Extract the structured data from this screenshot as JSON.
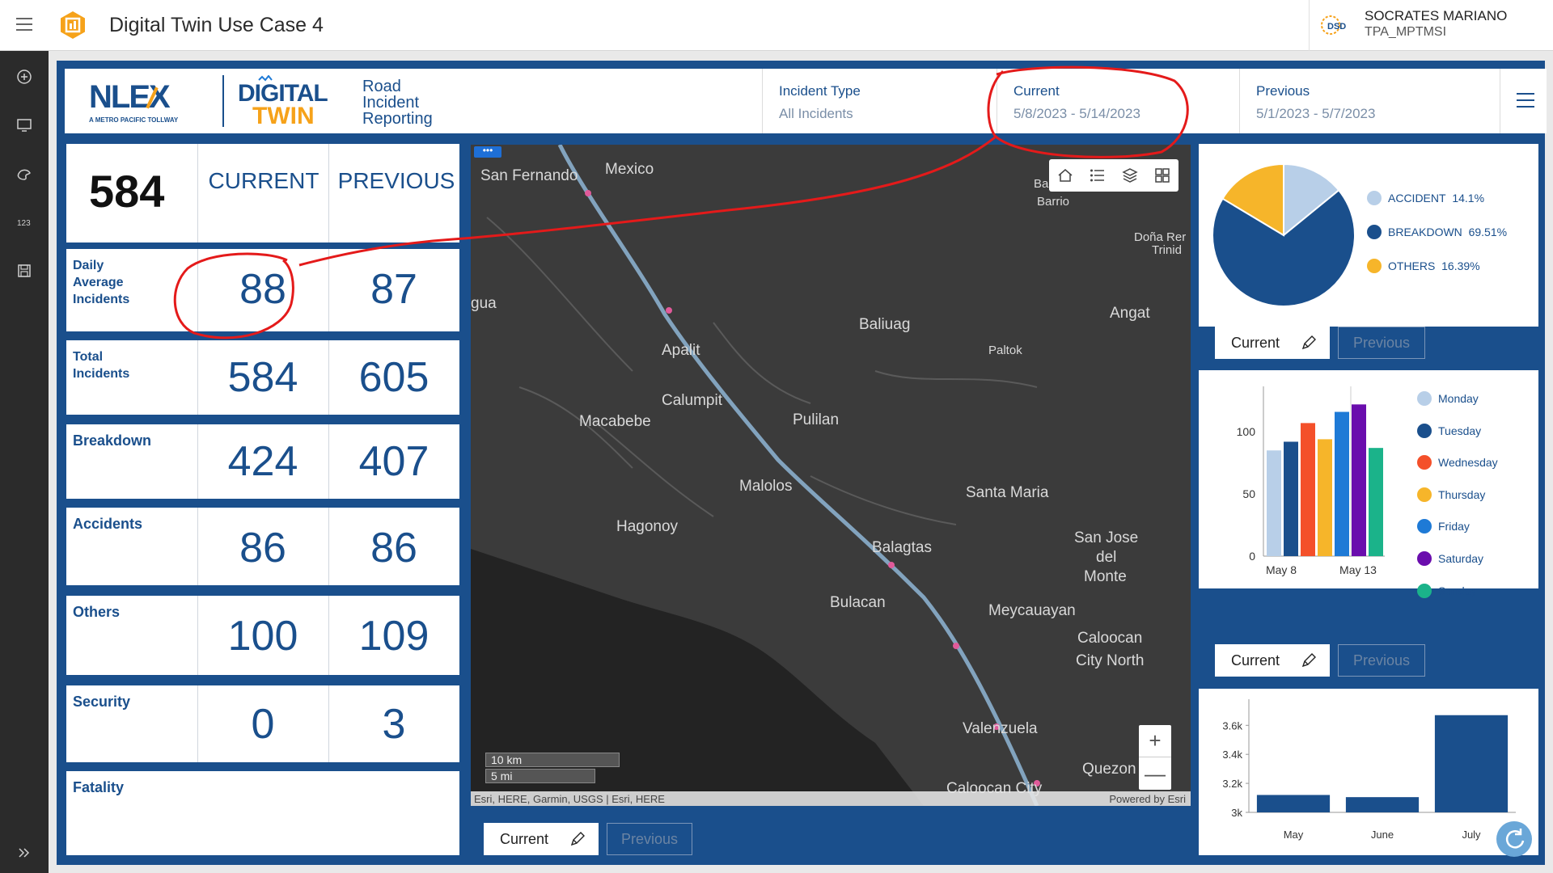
{
  "app": {
    "title": "Digital Twin Use Case 4"
  },
  "user": {
    "name": "SOCRATES MARIANO",
    "org": "TPA_MPTMSI",
    "badge": "DSD"
  },
  "header": {
    "logo_nlex": "NLEX",
    "logo_nlex_tag": "A METRO PACIFIC TOLLWAY",
    "logo_dt_1": "DIGITAL",
    "logo_dt_2": "TWIN",
    "logo_sub_1": "Road",
    "logo_sub_2": "Incident",
    "logo_sub_3": "Reporting",
    "incident_type_label": "Incident Type",
    "incident_type_value": "All Incidents",
    "current_label": "Current",
    "current_value": "5/8/2023 - 5/14/2023",
    "previous_label": "Previous",
    "previous_value": "5/1/2023 - 5/7/2023"
  },
  "stats": {
    "total": "584",
    "col_current": "CURRENT",
    "col_previous": "PREVIOUS",
    "rows": [
      {
        "label_1": "Daily",
        "label_2": "Average",
        "label_3": "Incidents",
        "current": "88",
        "previous": "87"
      },
      {
        "label_1": "Total",
        "label_2": "Incidents",
        "current": "584",
        "previous": "605"
      },
      {
        "label": "Breakdown",
        "current": "424",
        "previous": "407"
      },
      {
        "label": "Accidents",
        "current": "86",
        "previous": "86"
      },
      {
        "label": "Others",
        "current": "100",
        "previous": "109"
      },
      {
        "label": "Security",
        "current": "0",
        "previous": "3"
      },
      {
        "label": "Fatality"
      }
    ]
  },
  "map": {
    "places": [
      "San Fernando",
      "Mexico",
      "gua",
      "Apalit",
      "Baliuag",
      "Angat",
      "Paltok",
      "Calumpit",
      "Macabebe",
      "Pulilan",
      "Malolos",
      "Hagonoy",
      "Santa Maria",
      "Balagtas",
      "San Jose",
      "del",
      "Monte",
      "Bulacan",
      "Meycauayan",
      "Caloocan",
      "City North",
      "Valenzuela",
      "Caloocan City",
      "Quezon",
      "Ba",
      "Barrio",
      "Doña Rer",
      "Trinid"
    ],
    "scale_km": "10 km",
    "scale_mi": "5 mi",
    "attribution": "Esri, HERE, Garmin, USGS | Esri, HERE",
    "powered_by": "Powered by Esri",
    "zoom_in": "+",
    "zoom_out": "—",
    "tab_current": "Current",
    "tab_previous": "Previous"
  },
  "pie_panel": {
    "tab_current": "Current",
    "tab_previous": "Previous",
    "legend": [
      {
        "label": "ACCIDENT",
        "pct": "14.1%",
        "color": "#b8cfe8"
      },
      {
        "label": "BREAKDOWN",
        "pct": "69.51%",
        "color": "#1a4f8c"
      },
      {
        "label": "OTHERS",
        "pct": "16.39%",
        "color": "#f6b52a"
      }
    ]
  },
  "day_panel": {
    "tab_current": "Current",
    "tab_previous": "Previous",
    "x_start": "May 8",
    "x_end": "May 13",
    "legend": [
      {
        "label": "Monday",
        "color": "#b8cfe8"
      },
      {
        "label": "Tuesday",
        "color": "#1a4f8c"
      },
      {
        "label": "Wednesday",
        "color": "#f4502a"
      },
      {
        "label": "Thursday",
        "color": "#f6b52a"
      },
      {
        "label": "Friday",
        "color": "#1e7ad6"
      },
      {
        "label": "Saturday",
        "color": "#6a0dad"
      },
      {
        "label": "Sunday",
        "color": "#1bb38a"
      }
    ]
  },
  "chart_data": [
    {
      "type": "pie",
      "labels": [
        "ACCIDENT",
        "BREAKDOWN",
        "OTHERS"
      ],
      "values": [
        14.1,
        69.51,
        16.39
      ],
      "colors": [
        "#b8cfe8",
        "#1a4f8c",
        "#f6b52a"
      ],
      "legend": "right"
    },
    {
      "type": "bar",
      "categories": [
        "Monday",
        "Tuesday",
        "Wednesday",
        "Thursday",
        "Friday",
        "Saturday",
        "Sunday"
      ],
      "values": [
        85,
        92,
        107,
        94,
        116,
        122,
        87
      ],
      "colors": [
        "#b8cfe8",
        "#1a4f8c",
        "#f4502a",
        "#f6b52a",
        "#1e7ad6",
        "#6a0dad",
        "#1bb38a"
      ],
      "yticks": [
        0,
        50,
        100
      ],
      "ylim": [
        0,
        130
      ],
      "xticklabels": [
        "May 8",
        "May 13"
      ],
      "legend": "right"
    },
    {
      "type": "bar",
      "categories": [
        "May",
        "June",
        "July"
      ],
      "values": [
        3120,
        3105,
        3670
      ],
      "yticks": [
        "3k",
        "3.2k",
        "3.4k",
        "3.6k"
      ],
      "ytick_values": [
        3000,
        3200,
        3400,
        3600
      ],
      "ylim": [
        3000,
        3780
      ],
      "color": "#1a4f8c"
    }
  ]
}
